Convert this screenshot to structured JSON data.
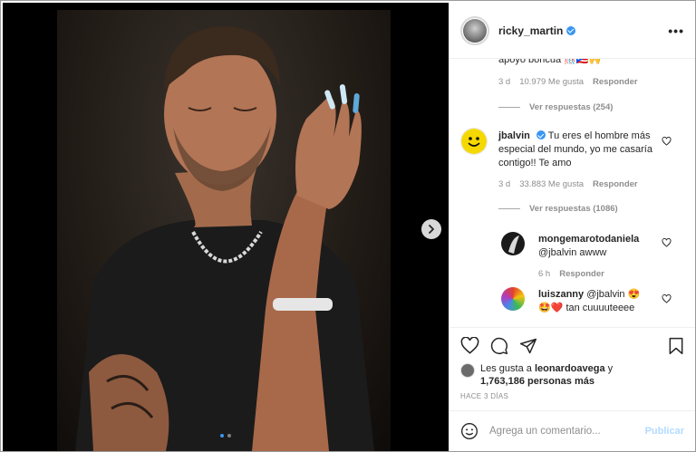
{
  "post": {
    "username": "ricky_martin",
    "more_icon": "more-horizontal-icon",
    "slides_total": 2,
    "current_slide": 1
  },
  "comments": [
    {
      "id": "partial",
      "text": "apoyo boricua 🎊🇵🇷🙌",
      "time": "3 d",
      "likes": "10.979 Me gusta",
      "reply": "Responder",
      "view_replies": "Ver respuestas (254)"
    },
    {
      "id": "jbalvin",
      "username": "jbalvin",
      "text": "Tu eres el hombre más especial del mundo, yo me casaría contigo!! Te amo",
      "time": "3 d",
      "likes": "33.883 Me gusta",
      "reply": "Responder",
      "view_replies": "Ver respuestas (1086)",
      "replies": [
        {
          "username": "mongemarotodaniela",
          "text": "@jbalvin awww",
          "time": "6 h",
          "reply": "Responder"
        },
        {
          "username": "luiszanny",
          "text_inline": "@jbalvin 😍",
          "text_line2": "🤩❤️ tan cuuuuteeee"
        }
      ]
    }
  ],
  "likes": {
    "prefix": "Les gusta a",
    "user": "leonardoavega",
    "suffix": "y",
    "count": "1,763,186 personas más"
  },
  "time_ago": "HACE 3 DÍAS",
  "composer": {
    "placeholder": "Agrega un comentario...",
    "publish": "Publicar"
  },
  "colors": {
    "verified": "#3897f0",
    "link_disabled": "#b3dbff",
    "muted": "#8e8e8e",
    "text": "#262626"
  }
}
